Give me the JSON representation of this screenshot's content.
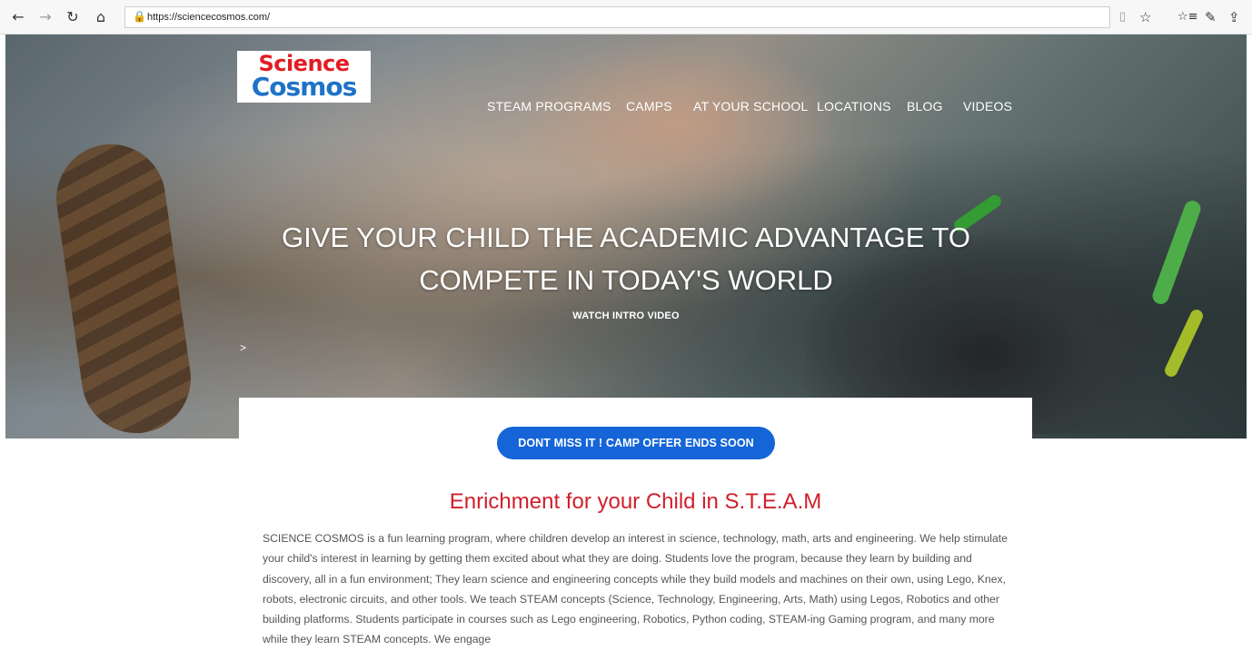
{
  "browser": {
    "url": "https://sciencecosmos.com/",
    "icons": {
      "back": "←",
      "forward": "→",
      "refresh": "↻",
      "home": "⌂",
      "lock": "🔒",
      "reading_view": "▯",
      "favorite": "☆",
      "favorites_list": "☆≡",
      "notes": "✎",
      "share": "⇪"
    }
  },
  "site": {
    "logo": {
      "line1": "Science",
      "line2": "Cosmos"
    },
    "menu": [
      {
        "label": "STEAM PROGRAMS"
      },
      {
        "label": "CAMPS"
      },
      {
        "label": "AT YOUR SCHOOL"
      },
      {
        "label": "LOCATIONS"
      },
      {
        "label": "BLOG"
      },
      {
        "label": "VIDEOS"
      }
    ],
    "hero": {
      "headline_line1": "GIVE YOUR CHILD THE ACADEMIC ADVANTAGE TO",
      "headline_line2": "COMPETE IN TODAY'S WORLD",
      "watch_label": "WATCH INTRO VIDEO",
      "slider_arrow": ">"
    },
    "cta_label": "DONT MISS IT ! CAMP OFFER ENDS SOON",
    "section_heading": "Enrichment for your Child in S.T.E.A.M",
    "paragraph": "SCIENCE COSMOS is a fun learning program, where children develop an interest in science, technology, math, arts and engineering. We help stimulate your child's interest in learning by getting them excited about what they are doing. Students love the program, because they learn by building and discovery, all in a fun environment; They learn science and engineering concepts  while they build models and machines on their own, using Lego, Knex, robots, electronic circuits, and other tools.  We teach STEAM concepts (Science, Technology, Engineering, Arts, Math) using Legos,  Robotics and other building platforms. Students participate in courses such as Lego engineering, Robotics, Python coding, STEAM-ing Gaming program,  and many more while they learn STEAM concepts.  We engage"
  },
  "colors": {
    "cta_blue": "#1565d8",
    "heading_red": "#d11f2a",
    "logo_red": "#e31b23",
    "logo_blue": "#1e72c8",
    "body_text": "#555555"
  }
}
